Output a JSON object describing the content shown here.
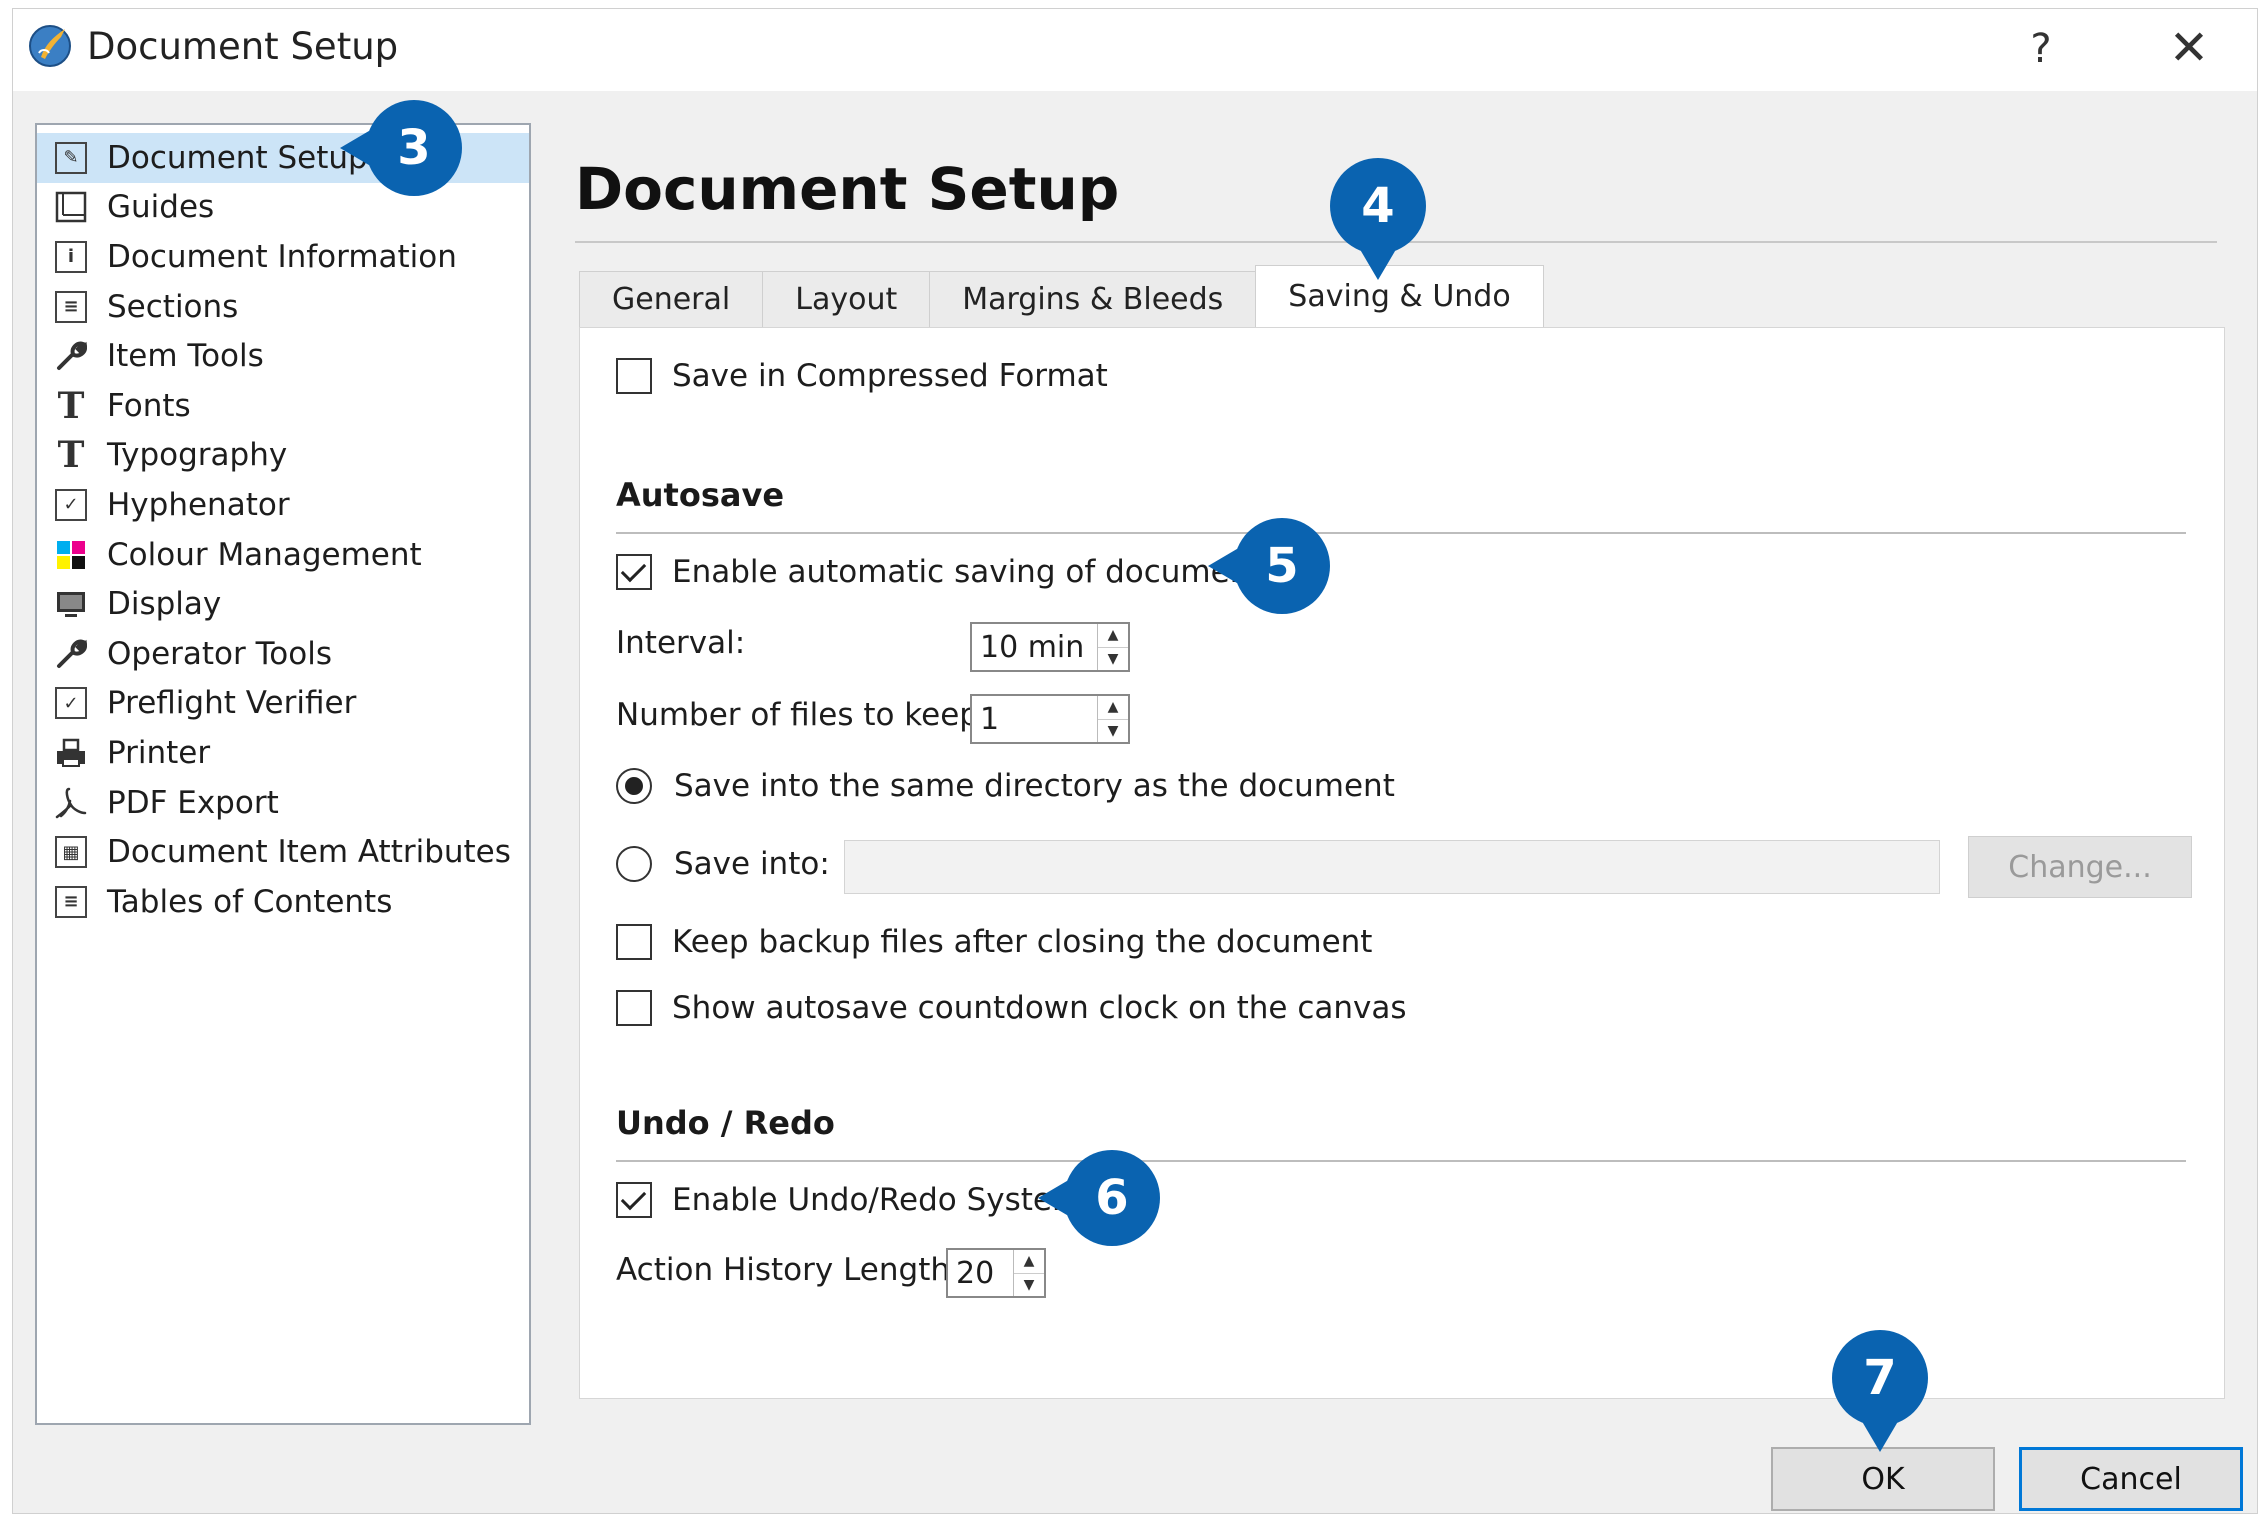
{
  "window": {
    "title": "Document Setup",
    "help_glyph": "?",
    "close_glyph": "✕"
  },
  "sidebar": {
    "items": [
      {
        "label": "Document Setup",
        "icon": "document-setup-icon",
        "glyph": "✎",
        "selected": true
      },
      {
        "label": "Guides",
        "icon": "guides-icon",
        "glyph": ""
      },
      {
        "label": "Document Information",
        "icon": "info-icon",
        "glyph": "i"
      },
      {
        "label": "Sections",
        "icon": "sections-icon",
        "glyph": "≡"
      },
      {
        "label": "Item Tools",
        "icon": "wrench-icon",
        "glyph": "🔧"
      },
      {
        "label": "Fonts",
        "icon": "fonts-icon",
        "glyph": "T"
      },
      {
        "label": "Typography",
        "icon": "typography-icon",
        "glyph": "T"
      },
      {
        "label": "Hyphenator",
        "icon": "checkbox-icon",
        "glyph": "✓"
      },
      {
        "label": "Colour Management",
        "icon": "colour-management-icon",
        "glyph": ""
      },
      {
        "label": "Display",
        "icon": "display-icon",
        "glyph": ""
      },
      {
        "label": "Operator Tools",
        "icon": "wrench-icon",
        "glyph": "🔧"
      },
      {
        "label": "Preflight Verifier",
        "icon": "checkbox-icon",
        "glyph": "✓"
      },
      {
        "label": "Printer",
        "icon": "printer-icon",
        "glyph": ""
      },
      {
        "label": "PDF Export",
        "icon": "pdf-icon",
        "glyph": "⅄"
      },
      {
        "label": "Document Item Attributes",
        "icon": "attributes-icon",
        "glyph": "▦"
      },
      {
        "label": "Tables of Contents",
        "icon": "toc-icon",
        "glyph": "≡"
      }
    ]
  },
  "main": {
    "title": "Document Setup",
    "tabs": [
      {
        "label": "General",
        "active": false
      },
      {
        "label": "Layout",
        "active": false
      },
      {
        "label": "Margins & Bleeds",
        "active": false
      },
      {
        "label": "Saving & Undo",
        "active": true
      }
    ],
    "save_compressed": {
      "label": "Save in Compressed Format",
      "checked": false
    },
    "autosave": {
      "heading": "Autosave",
      "enable": {
        "label": "Enable automatic saving of documents",
        "checked": true
      },
      "interval_label": "Interval:",
      "interval_value": "10 min",
      "files_label": "Number of files to keep:",
      "files_value": "1",
      "same_dir": {
        "label": "Save into the same directory as the document",
        "checked": true
      },
      "save_into": {
        "label": "Save into:",
        "checked": false,
        "value": ""
      },
      "change_button": "Change...",
      "keep_backup": {
        "label": "Keep backup files after closing the document",
        "checked": false
      },
      "show_clock": {
        "label": "Show autosave countdown clock on the canvas",
        "checked": false
      }
    },
    "undo": {
      "heading": "Undo / Redo",
      "enable": {
        "label": "Enable Undo/Redo System",
        "checked": true
      },
      "history_label": "Action History Length:",
      "history_value": "20"
    }
  },
  "buttons": {
    "ok": "OK",
    "cancel": "Cancel"
  },
  "markers": [
    "3",
    "4",
    "5",
    "6",
    "7"
  ],
  "colors": {
    "marker": "#0a63b0",
    "selection": "#cce4f7",
    "default_button_border": "#0078d7"
  }
}
